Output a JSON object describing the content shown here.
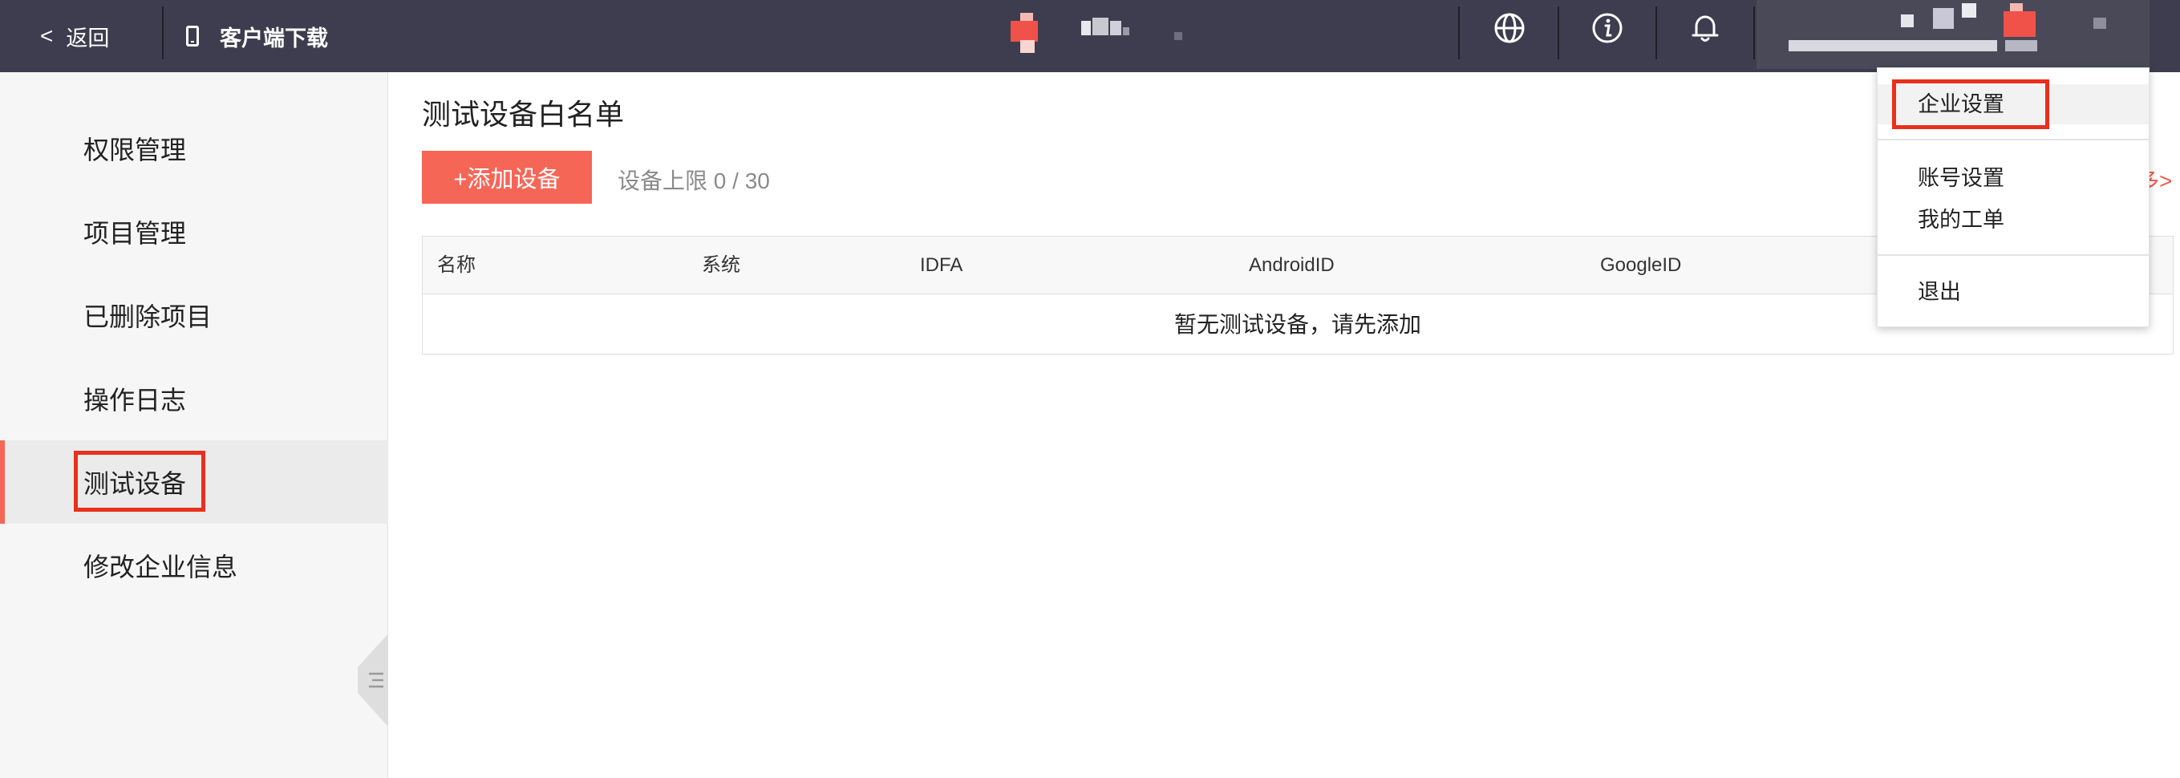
{
  "topbar": {
    "back_label": "返回",
    "back_chevron": "<",
    "download_label": "客户端下载",
    "icons": [
      "globe-icon",
      "info-icon",
      "bell-icon"
    ]
  },
  "sidebar": {
    "items": [
      {
        "label": "权限管理"
      },
      {
        "label": "项目管理"
      },
      {
        "label": "已删除项目"
      },
      {
        "label": "操作日志"
      },
      {
        "label": "测试设备",
        "active": true
      },
      {
        "label": "修改企业信息"
      }
    ]
  },
  "main": {
    "title": "测试设备白名单",
    "add_button": "+添加设备",
    "limit_text": "设备上限 0 / 30",
    "more_link": "多>",
    "table": {
      "columns": [
        "名称",
        "系统",
        "IDFA",
        "AndroidID",
        "GoogleID"
      ],
      "empty_text": "暂无测试设备，请先添加"
    }
  },
  "dropdown": {
    "items": [
      "企业设置",
      "账号设置",
      "我的工单",
      "退出"
    ]
  },
  "colors": {
    "topbar": "#3e3d4f",
    "accent": "#f66657",
    "highlight": "#e8301c"
  }
}
